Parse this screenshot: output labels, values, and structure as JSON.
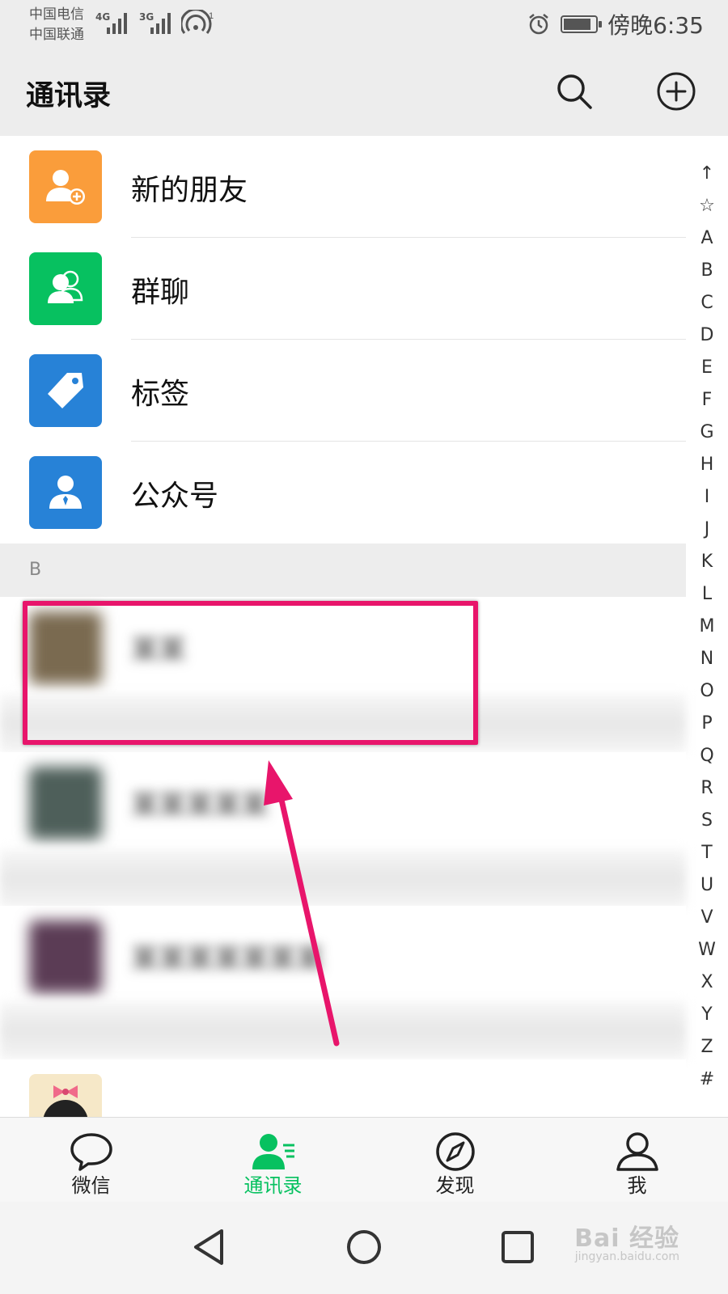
{
  "status_bar": {
    "carrier_1": "中国电信",
    "carrier_2": "中国联通",
    "net_1": "4G",
    "net_2": "3G",
    "hotspot_count": "1",
    "time": "傍晚6:35"
  },
  "header": {
    "title": "通讯录",
    "search_icon": "search-icon",
    "add_icon": "plus-circle-icon"
  },
  "functions": [
    {
      "label": "新的朋友",
      "color": "#fa9d3b",
      "icon": "add-friend-icon"
    },
    {
      "label": "群聊",
      "color": "#07c160",
      "icon": "group-chat-icon"
    },
    {
      "label": "标签",
      "color": "#2782d7",
      "icon": "tag-icon"
    },
    {
      "label": "公众号",
      "color": "#2782d7",
      "icon": "official-account-icon"
    }
  ],
  "section": {
    "letter": "B"
  },
  "contacts": [
    {
      "name": "某某",
      "avatar_color": "#7a6a50"
    },
    {
      "name": "某某某某某",
      "avatar_color": "#4e5f5a"
    },
    {
      "name": "某某某某某某某",
      "avatar_color": "#5b3c55"
    }
  ],
  "alphabet_index": [
    "↑",
    "☆",
    "A",
    "B",
    "C",
    "D",
    "E",
    "F",
    "G",
    "H",
    "I",
    "J",
    "K",
    "L",
    "M",
    "N",
    "O",
    "P",
    "Q",
    "R",
    "S",
    "T",
    "U",
    "V",
    "W",
    "X",
    "Y",
    "Z",
    "#"
  ],
  "tabs": [
    {
      "label": "微信",
      "icon": "chat-bubble-icon",
      "active": false
    },
    {
      "label": "通讯录",
      "icon": "contacts-icon",
      "active": true
    },
    {
      "label": "发现",
      "icon": "compass-icon",
      "active": false
    },
    {
      "label": "我",
      "icon": "person-icon",
      "active": false
    }
  ],
  "annotation": {
    "highlight_color": "#e8156b"
  },
  "watermark": {
    "text": "Bai 经验",
    "subtext": "jingyan.baidu.com"
  },
  "colors": {
    "accent": "#07c160",
    "background": "#ededed"
  }
}
